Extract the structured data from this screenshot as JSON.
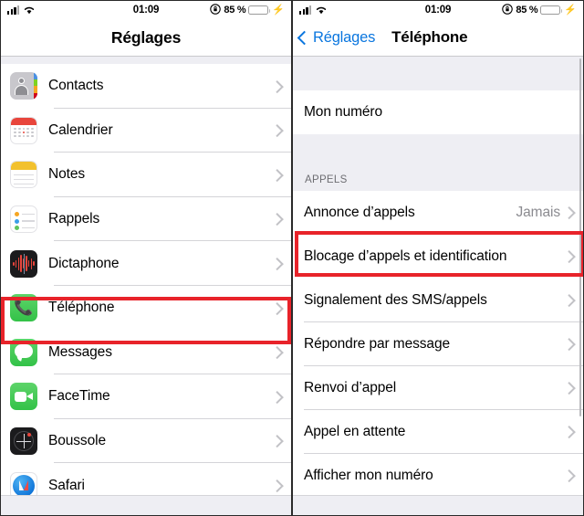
{
  "status_bar": {
    "time": "01:09",
    "battery_percent": "85 %",
    "battery_level": 85,
    "signal_icon": "cellular-signal-icon",
    "wifi_icon": "wifi-icon",
    "lock_icon": "orientation-lock-icon",
    "battery_icon": "battery-icon",
    "charging_icon": "lightning-bolt-icon",
    "battery_color": "#4cd763"
  },
  "left_panel": {
    "title": "Réglages",
    "items": [
      {
        "label": "Contacts",
        "icon": "contacts-app-icon",
        "highlighted": false
      },
      {
        "label": "Calendrier",
        "icon": "calendar-app-icon",
        "highlighted": false
      },
      {
        "label": "Notes",
        "icon": "notes-app-icon",
        "highlighted": false
      },
      {
        "label": "Rappels",
        "icon": "reminders-app-icon",
        "highlighted": false
      },
      {
        "label": "Dictaphone",
        "icon": "voice-memos-app-icon",
        "highlighted": false
      },
      {
        "label": "Téléphone",
        "icon": "phone-app-icon",
        "highlighted": true
      },
      {
        "label": "Messages",
        "icon": "messages-app-icon",
        "highlighted": false
      },
      {
        "label": "FaceTime",
        "icon": "facetime-app-icon",
        "highlighted": false
      },
      {
        "label": "Boussole",
        "icon": "compass-app-icon",
        "highlighted": false
      },
      {
        "label": "Safari",
        "icon": "safari-app-icon",
        "highlighted": false
      }
    ]
  },
  "right_panel": {
    "back_label": "Réglages",
    "title": "Téléphone",
    "first_section": [
      {
        "label": "Mon numéro",
        "value": "",
        "chevron": false
      }
    ],
    "section_header": "APPELS",
    "items": [
      {
        "label": "Annonce d’appels",
        "value": "Jamais",
        "highlighted": false
      },
      {
        "label": "Blocage d’appels et identification",
        "value": "",
        "highlighted": true
      },
      {
        "label": "Signalement des SMS/appels",
        "value": "",
        "highlighted": false
      },
      {
        "label": "Répondre par message",
        "value": "",
        "highlighted": false
      },
      {
        "label": "Renvoi d’appel",
        "value": "",
        "highlighted": false
      },
      {
        "label": "Appel en attente",
        "value": "",
        "highlighted": false
      },
      {
        "label": "Afficher mon numéro",
        "value": "",
        "highlighted": false
      }
    ]
  },
  "annotations": {
    "highlight_color": "#e8232a",
    "boxes": [
      "telephone-row-highlight",
      "blocage-appels-row-highlight"
    ]
  }
}
